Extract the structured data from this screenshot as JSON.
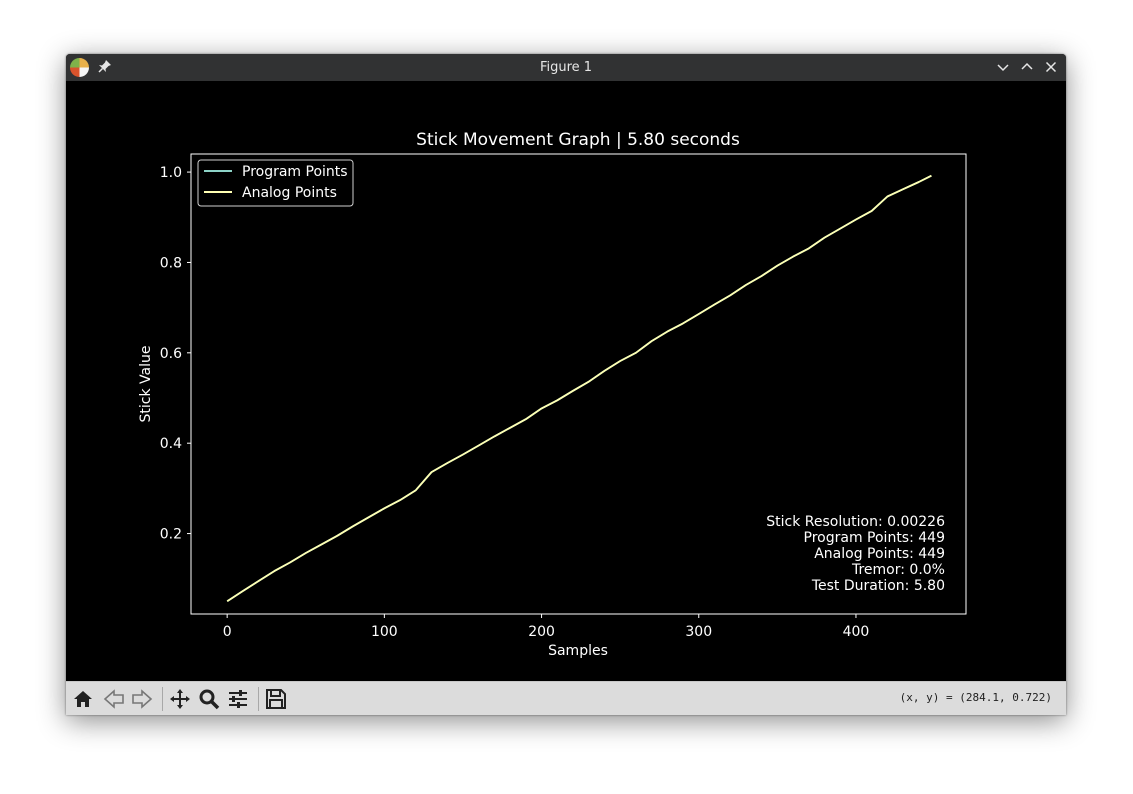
{
  "window": {
    "title": "Figure 1"
  },
  "chart_data": {
    "type": "line",
    "title": "Stick Movement Graph | 5.80 seconds",
    "xlabel": "Samples",
    "ylabel": "Stick Value",
    "xlim": [
      -23,
      470
    ],
    "ylim": [
      0.022,
      1.04
    ],
    "xticks": [
      0,
      100,
      200,
      300,
      400
    ],
    "yticks": [
      0.2,
      0.4,
      0.6,
      0.8,
      1.0
    ],
    "xtick_labels": [
      "0",
      "100",
      "200",
      "300",
      "400"
    ],
    "ytick_labels": [
      "0.2",
      "0.4",
      "0.6",
      "0.8",
      "1.0"
    ],
    "grid": false,
    "legend_position": "upper left",
    "series": [
      {
        "name": "Program Points",
        "color": "#8dd3c7",
        "x": [
          0,
          10,
          20,
          30,
          40,
          50,
          60,
          70,
          80,
          90,
          100,
          110,
          120,
          130,
          140,
          150,
          160,
          170,
          180,
          190,
          200,
          210,
          220,
          230,
          240,
          250,
          260,
          270,
          280,
          290,
          300,
          310,
          320,
          330,
          340,
          350,
          360,
          370,
          380,
          390,
          400,
          410,
          420,
          430,
          440,
          448
        ],
        "values": [
          0.05,
          0.073,
          0.095,
          0.117,
          0.136,
          0.157,
          0.176,
          0.195,
          0.216,
          0.236,
          0.256,
          0.274,
          0.296,
          0.336,
          0.356,
          0.375,
          0.395,
          0.415,
          0.434,
          0.453,
          0.477,
          0.495,
          0.516,
          0.536,
          0.56,
          0.582,
          0.6,
          0.626,
          0.647,
          0.665,
          0.686,
          0.707,
          0.727,
          0.75,
          0.77,
          0.793,
          0.813,
          0.831,
          0.855,
          0.875,
          0.895,
          0.914,
          0.946,
          0.962,
          0.978,
          0.992
        ]
      },
      {
        "name": "Analog Points",
        "color": "#ffffb3",
        "x": [
          0,
          10,
          20,
          30,
          40,
          50,
          60,
          70,
          80,
          90,
          100,
          110,
          120,
          130,
          140,
          150,
          160,
          170,
          180,
          190,
          200,
          210,
          220,
          230,
          240,
          250,
          260,
          270,
          280,
          290,
          300,
          310,
          320,
          330,
          340,
          350,
          360,
          370,
          380,
          390,
          400,
          410,
          420,
          430,
          440,
          448
        ],
        "values": [
          0.05,
          0.073,
          0.095,
          0.117,
          0.136,
          0.157,
          0.176,
          0.195,
          0.216,
          0.236,
          0.256,
          0.274,
          0.296,
          0.336,
          0.356,
          0.375,
          0.395,
          0.415,
          0.434,
          0.453,
          0.477,
          0.495,
          0.516,
          0.536,
          0.56,
          0.582,
          0.6,
          0.626,
          0.647,
          0.665,
          0.686,
          0.707,
          0.727,
          0.75,
          0.77,
          0.793,
          0.813,
          0.831,
          0.855,
          0.875,
          0.895,
          0.914,
          0.946,
          0.962,
          0.978,
          0.992
        ]
      }
    ],
    "annotations": [
      "Stick Resolution: 0.00226",
      "Program Points: 449",
      "Analog Points: 449",
      "Tremor: 0.0%",
      "Test Duration: 5.80"
    ]
  },
  "toolbar": {
    "buttons": [
      {
        "name": "home",
        "icon": "home-icon"
      },
      {
        "name": "back",
        "icon": "back-arrow-icon"
      },
      {
        "name": "forward",
        "icon": "forward-arrow-icon"
      },
      {
        "name": "pan",
        "icon": "move-icon"
      },
      {
        "name": "zoom",
        "icon": "magnifier-icon"
      },
      {
        "name": "configure",
        "icon": "sliders-icon"
      },
      {
        "name": "save",
        "icon": "floppy-disk-icon"
      }
    ],
    "coords": "(x, y) = (284.1, 0.722)"
  }
}
